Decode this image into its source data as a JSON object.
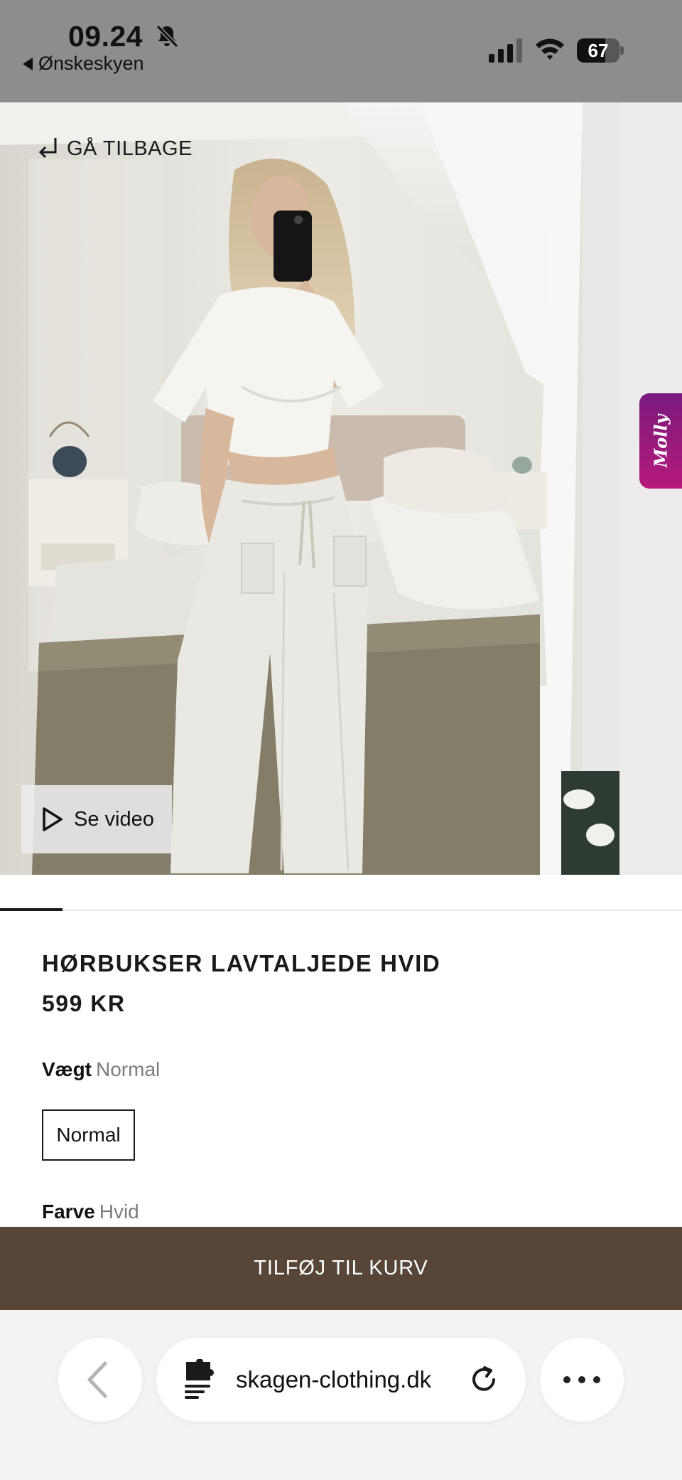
{
  "status_bar": {
    "time": "09.24",
    "back_app": "Ønskeskyen",
    "battery_percent": "67",
    "battery_level": 0.67,
    "icons": [
      "bell-slash-icon",
      "signal-icon",
      "wifi-icon",
      "battery-icon"
    ]
  },
  "hero": {
    "go_back_label": "GÅ TILBAGE",
    "video_label": "Se video",
    "molly_badge": "Molly",
    "image_alt": "Woman in white t-shirt and white linen trousers taking a mirror selfie in a bedroom"
  },
  "carousel": {
    "active_index": 1
  },
  "product": {
    "title": "HØRBUKSER LAVTALJEDE HVID",
    "price": "599 KR",
    "weight_label": "Vægt",
    "weight_value": "Normal",
    "weight_option": "Normal",
    "color_label": "Farve",
    "color_value": "Hvid"
  },
  "cart": {
    "button_label": "TILFØJ TIL KURV"
  },
  "browser": {
    "url": "skagen-clothing.dk"
  },
  "colors": {
    "status_bar_bg": "#8d8d8d",
    "cart_button_bg": "#574538",
    "molly_badge": "#9a1a7c",
    "browser_bg": "#f3f3f3"
  }
}
